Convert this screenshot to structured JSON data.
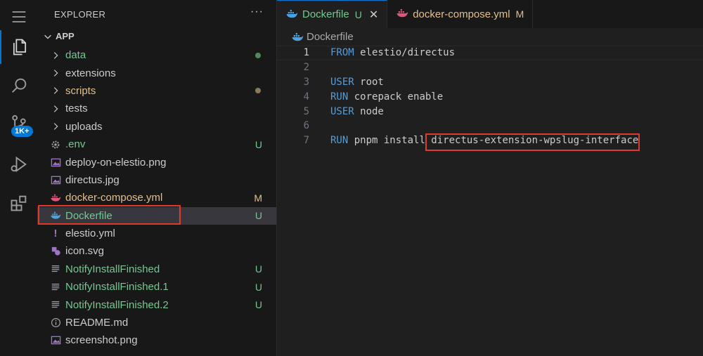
{
  "colors": {
    "untracked": "#73c991",
    "modified": "#e2c08d",
    "accent": "#0078d4",
    "highlight": "#e03a2f",
    "keyword": "#569cd6"
  },
  "activity_bar": {
    "source_control_badge": "1K+"
  },
  "explorer": {
    "title": "EXPLORER",
    "more": "···",
    "root": "APP",
    "items": [
      {
        "label": "data",
        "type": "folder",
        "color": "#73c991",
        "status": "dot-green"
      },
      {
        "label": "extensions",
        "type": "folder",
        "color": "#cccccc",
        "status": ""
      },
      {
        "label": "scripts",
        "type": "folder",
        "color": "#e2c08d",
        "status": "dot-brown"
      },
      {
        "label": "tests",
        "type": "folder",
        "color": "#cccccc",
        "status": ""
      },
      {
        "label": "uploads",
        "type": "folder",
        "color": "#cccccc",
        "status": ""
      },
      {
        "label": ".env",
        "type": "gear",
        "color": "#73c991",
        "status": "U"
      },
      {
        "label": "deploy-on-elestio.png",
        "type": "image",
        "color": "#cccccc",
        "status": ""
      },
      {
        "label": "directus.jpg",
        "type": "image",
        "color": "#cccccc",
        "status": ""
      },
      {
        "label": "docker-compose.yml",
        "type": "docker-pink",
        "color": "#e2c08d",
        "status": "M"
      },
      {
        "label": "Dockerfile",
        "type": "docker-blue",
        "color": "#73c991",
        "status": "U"
      },
      {
        "label": "elestio.yml",
        "type": "yaml",
        "color": "#cccccc",
        "status": ""
      },
      {
        "label": "icon.svg",
        "type": "svg",
        "color": "#cccccc",
        "status": ""
      },
      {
        "label": "NotifyInstallFinished",
        "type": "text",
        "color": "#73c991",
        "status": "U"
      },
      {
        "label": "NotifyInstallFinished.1",
        "type": "text",
        "color": "#73c991",
        "status": "U"
      },
      {
        "label": "NotifyInstallFinished.2",
        "type": "text",
        "color": "#73c991",
        "status": "U"
      },
      {
        "label": "README.md",
        "type": "info",
        "color": "#cccccc",
        "status": ""
      },
      {
        "label": "screenshot.png",
        "type": "image",
        "color": "#cccccc",
        "status": ""
      }
    ]
  },
  "tabs": [
    {
      "label": "Dockerfile",
      "status": "U",
      "active": true
    },
    {
      "label": "docker-compose.yml",
      "status": "M",
      "active": false
    }
  ],
  "breadcrumb": "Dockerfile",
  "code_lines": [
    {
      "num": "1",
      "kw": "FROM",
      "rest": " elestio/directus"
    },
    {
      "num": "2",
      "kw": "",
      "rest": ""
    },
    {
      "num": "3",
      "kw": "USER",
      "rest": " root"
    },
    {
      "num": "4",
      "kw": "RUN",
      "rest": " corepack enable"
    },
    {
      "num": "5",
      "kw": "USER",
      "rest": " node"
    },
    {
      "num": "6",
      "kw": "",
      "rest": ""
    },
    {
      "num": "7",
      "kw": "RUN",
      "rest": " pnpm install directus-extension-wpslug-interface"
    }
  ]
}
